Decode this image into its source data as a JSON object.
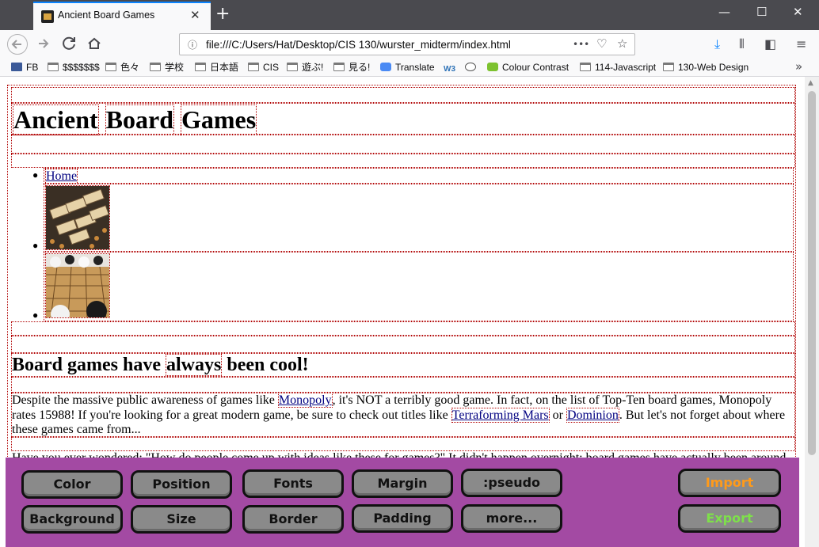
{
  "browser": {
    "tab_title": "Ancient Board Games",
    "tab_close": "✕",
    "new_tab": "+",
    "window_controls": {
      "minimize": "—",
      "maximize": "☐",
      "close": "✕"
    },
    "url": "file:///C:/Users/Hat/Desktop/CIS 130/wurster_midterm/index.html",
    "url_actions": {
      "more": "•••",
      "pocket": "♡",
      "star": "☆"
    },
    "icons": {
      "back": "back-arrow-icon",
      "forward": "forward-arrow-icon",
      "reload": "reload-icon",
      "home": "home-icon"
    }
  },
  "bookmarks": [
    {
      "label": "FB",
      "icon": "fb"
    },
    {
      "label": "$$$$$$$",
      "icon": "folder"
    },
    {
      "label": "色々",
      "icon": "folder"
    },
    {
      "label": "学校",
      "icon": "folder"
    },
    {
      "label": "日本語",
      "icon": "folder"
    },
    {
      "label": "CIS",
      "icon": "folder"
    },
    {
      "label": "遊ぶ!",
      "icon": "folder"
    },
    {
      "label": "見る!",
      "icon": "folder"
    },
    {
      "label": "Translate",
      "icon": "translate"
    },
    {
      "label": "",
      "icon": "w3"
    },
    {
      "label": "",
      "icon": "globe"
    },
    {
      "label": "Colour Contrast",
      "icon": "contrast"
    },
    {
      "label": "114-Javascript",
      "icon": "folder"
    },
    {
      "label": "130-Web Design",
      "icon": "folder"
    }
  ],
  "page": {
    "h1_words": [
      "Ancient",
      "Board",
      "Games"
    ],
    "nav": {
      "home_link": "Home"
    },
    "h2": {
      "before": "Board games have ",
      "emphasis": "always",
      "after": " been cool!"
    },
    "paragraph": {
      "t1": "Despite the massive public awareness of games like ",
      "link1": "Monopoly",
      "t2": ", it's NOT a terribly good game. In fact, on the list of Top-Ten board games, Monopoly rates 15988! If you're looking for a great modern game, be sure to check out titles like ",
      "link2": "Terraforming Mars",
      "t3": " or ",
      "link3": "Dominion",
      "t4": ". But let's not forget about where these games came from..."
    },
    "paragraph2": "Have you ever wondered: \"How do people come up with ideas like these for games?\" It didn't happen overnight; board games have actually been around"
  },
  "tool_panel": {
    "row1": [
      "Color",
      "Position",
      "Fonts",
      "Margin",
      ":pseudo"
    ],
    "row2": [
      "Background",
      "Size",
      "Border",
      "Padding",
      "more..."
    ],
    "import": "Import",
    "export": "Export"
  },
  "colors": {
    "panel": "#a34aa3",
    "button": "#8a8a8a",
    "import": "#ff9a1a",
    "export": "#7ee04a",
    "outline": "#b00000"
  }
}
